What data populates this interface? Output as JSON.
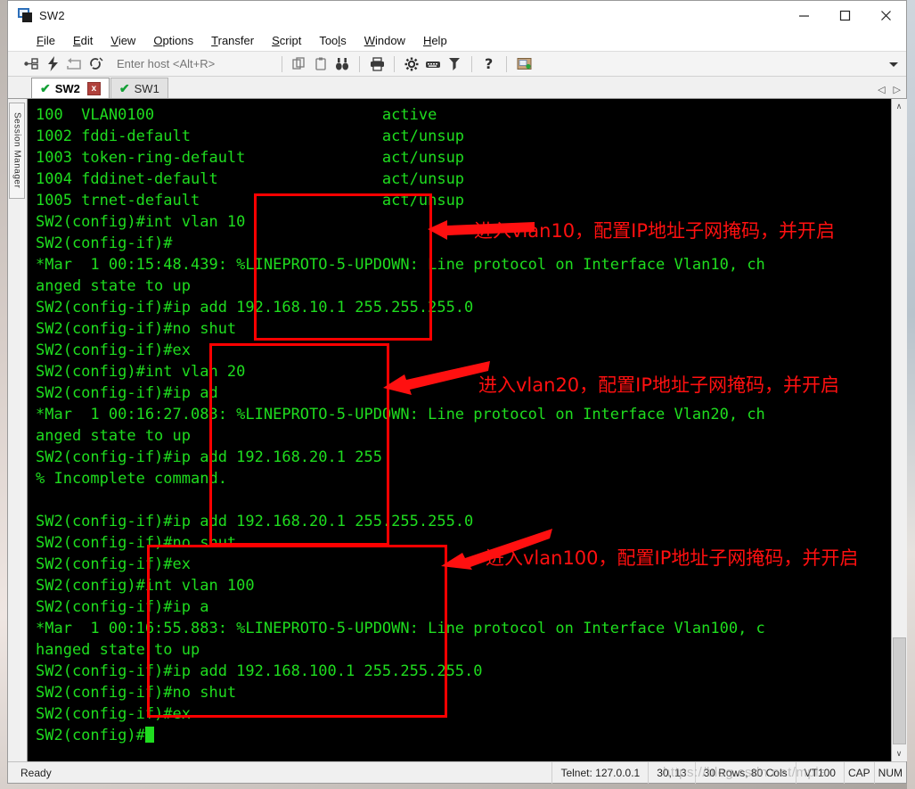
{
  "window": {
    "title": "SW2",
    "icon": "securecrt-app-icon",
    "controls": {
      "minimize": "minimize-icon",
      "maximize": "maximize-icon",
      "close": "close-icon"
    }
  },
  "menu": {
    "items": [
      {
        "label": "File",
        "accel": "F"
      },
      {
        "label": "Edit",
        "accel": "E"
      },
      {
        "label": "View",
        "accel": "V"
      },
      {
        "label": "Options",
        "accel": "O"
      },
      {
        "label": "Transfer",
        "accel": "T"
      },
      {
        "label": "Script",
        "accel": "S"
      },
      {
        "label": "Tools",
        "accel": "l"
      },
      {
        "label": "Window",
        "accel": "W"
      },
      {
        "label": "Help",
        "accel": "H"
      }
    ]
  },
  "toolbar": {
    "host_placeholder": "Enter host <Alt+R>",
    "host_value": "",
    "icons": [
      "new-session-icon",
      "quick-connect-icon",
      "reconnect-icon",
      "disconnect-icon"
    ],
    "icons2": [
      "copy-icon",
      "paste-icon",
      "find-icon"
    ],
    "icons3": [
      "print-icon"
    ],
    "icons4": [
      "session-options-icon",
      "keymap-editor-icon",
      "key-icon"
    ],
    "icons5": [
      "help-icon"
    ],
    "icons6": [
      "transfer-window-icon"
    ],
    "overflow": "toolbar-overflow-chevron"
  },
  "sidebar": {
    "session_manager_label": "Session Manager"
  },
  "tabs": {
    "items": [
      {
        "label": "SW2",
        "active": true,
        "status": "connected",
        "closable": true,
        "close_label": "x"
      },
      {
        "label": "SW1",
        "active": false,
        "status": "connected",
        "closable": false,
        "close_label": ""
      }
    ],
    "nav_prev": "◁",
    "nav_next": "▷"
  },
  "terminal": {
    "fg_color": "#1fdd1f",
    "bg_color": "#000000",
    "lines": [
      "100  VLAN0100                         active",
      "1002 fddi-default                     act/unsup",
      "1003 token-ring-default               act/unsup",
      "1004 fddinet-default                  act/unsup",
      "1005 trnet-default                    act/unsup",
      "SW2(config)#int vlan 10",
      "SW2(config-if)#",
      "*Mar  1 00:15:48.439: %LINEPROTO-5-UPDOWN: Line protocol on Interface Vlan10, ch",
      "anged state to up",
      "SW2(config-if)#ip add 192.168.10.1 255.255.255.0",
      "SW2(config-if)#no shut",
      "SW2(config-if)#ex",
      "SW2(config)#int vlan 20",
      "SW2(config-if)#ip ad",
      "*Mar  1 00:16:27.083: %LINEPROTO-5-UPDOWN: Line protocol on Interface Vlan20, ch",
      "anged state to up",
      "SW2(config-if)#ip add 192.168.20.1 255",
      "% Incomplete command.",
      "",
      "SW2(config-if)#ip add 192.168.20.1 255.255.255.0",
      "SW2(config-if)#no shut",
      "SW2(config-if)#ex",
      "SW2(config)#int vlan 100",
      "SW2(config-if)#ip a",
      "*Mar  1 00:16:55.883: %LINEPROTO-5-UPDOWN: Line protocol on Interface Vlan100, c",
      "hanged state to up",
      "SW2(config-if)#ip add 192.168.100.1 255.255.255.0",
      "SW2(config-if)#no shut",
      "SW2(config-if)#ex",
      "SW2(config)#"
    ]
  },
  "annotations": [
    {
      "id": "anno-vlan10",
      "text": "进入vlan10，配置IP地址子网掩码，并开启",
      "color": "#ff1010"
    },
    {
      "id": "anno-vlan20",
      "text": "进入vlan20，配置IP地址子网掩码，并开启",
      "color": "#ff1010"
    },
    {
      "id": "anno-vlan100",
      "text": "进入vlan100，配置IP地址子网掩码，并开启",
      "color": "#ff1010"
    }
  ],
  "status_bar": {
    "ready": "Ready",
    "connection": "Telnet: 127.0.0.1",
    "cursor_pos": "30, 13",
    "screen_size": "30 Rows, 80 Cols",
    "emulation": "VT100",
    "caps": "CAP",
    "num": "NUM",
    "watermark": "https://blog.csdn.net/mpia"
  },
  "scrollbar": {
    "up_arrow": "∧",
    "down_arrow": "∨"
  }
}
